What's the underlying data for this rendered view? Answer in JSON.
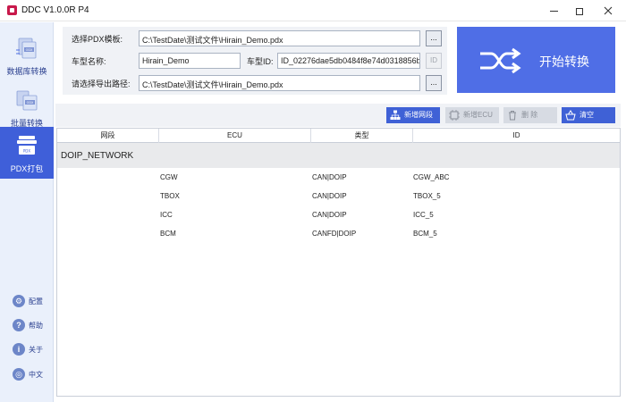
{
  "window": {
    "title": "DDC V1.0.0R P4"
  },
  "sidebar": {
    "nav": [
      {
        "label": "数据库转换",
        "icon": "database-convert-icon"
      },
      {
        "label": "批量转换",
        "icon": "batch-convert-icon"
      },
      {
        "label": "PDX打包",
        "icon": "pdx-package-icon",
        "active": true
      }
    ],
    "utils": [
      {
        "label": "配置",
        "icon": "config-icon"
      },
      {
        "label": "帮助",
        "icon": "help-icon"
      },
      {
        "label": "关于",
        "icon": "about-icon"
      },
      {
        "label": "中文",
        "icon": "language-icon"
      }
    ]
  },
  "form": {
    "pdx_template_label": "选择PDX模板:",
    "pdx_template_value": "C:\\TestDate\\测试文件\\Hirain_Demo.pdx",
    "model_name_label": "车型名称:",
    "model_name_value": "Hirain_Demo",
    "model_id_label": "车型ID:",
    "model_id_value": "ID_02276dae5db0484f8e74d0318856b",
    "id_button": "ID",
    "export_path_label": "请选择导出路径:",
    "export_path_value": "C:\\TestDate\\测试文件\\Hirain_Demo.pdx",
    "browse_label": "..."
  },
  "start_button": {
    "label": "开始转换",
    "icon": "shuffle-icon"
  },
  "toolbar": {
    "add_segment": "新增网段",
    "add_ecu": "新增ECU",
    "delete": "删 除",
    "clear": "清空"
  },
  "table": {
    "columns": [
      "网段",
      "ECU",
      "类型",
      "ID"
    ],
    "group": "DOIP_NETWORK",
    "rows": [
      {
        "ecu": "CGW",
        "type": "CAN|DOIP",
        "id": "CGW_ABC"
      },
      {
        "ecu": "TBOX",
        "type": "CAN|DOIP",
        "id": "TBOX_5"
      },
      {
        "ecu": "ICC",
        "type": "CAN|DOIP",
        "id": "ICC_5"
      },
      {
        "ecu": "BCM",
        "type": "CANFD|DOIP",
        "id": "BCM_5"
      }
    ]
  },
  "colors": {
    "accent": "#4f6ee6",
    "sidebar_bg": "#eaf0fb",
    "active_nav": "#3f5fd9"
  }
}
